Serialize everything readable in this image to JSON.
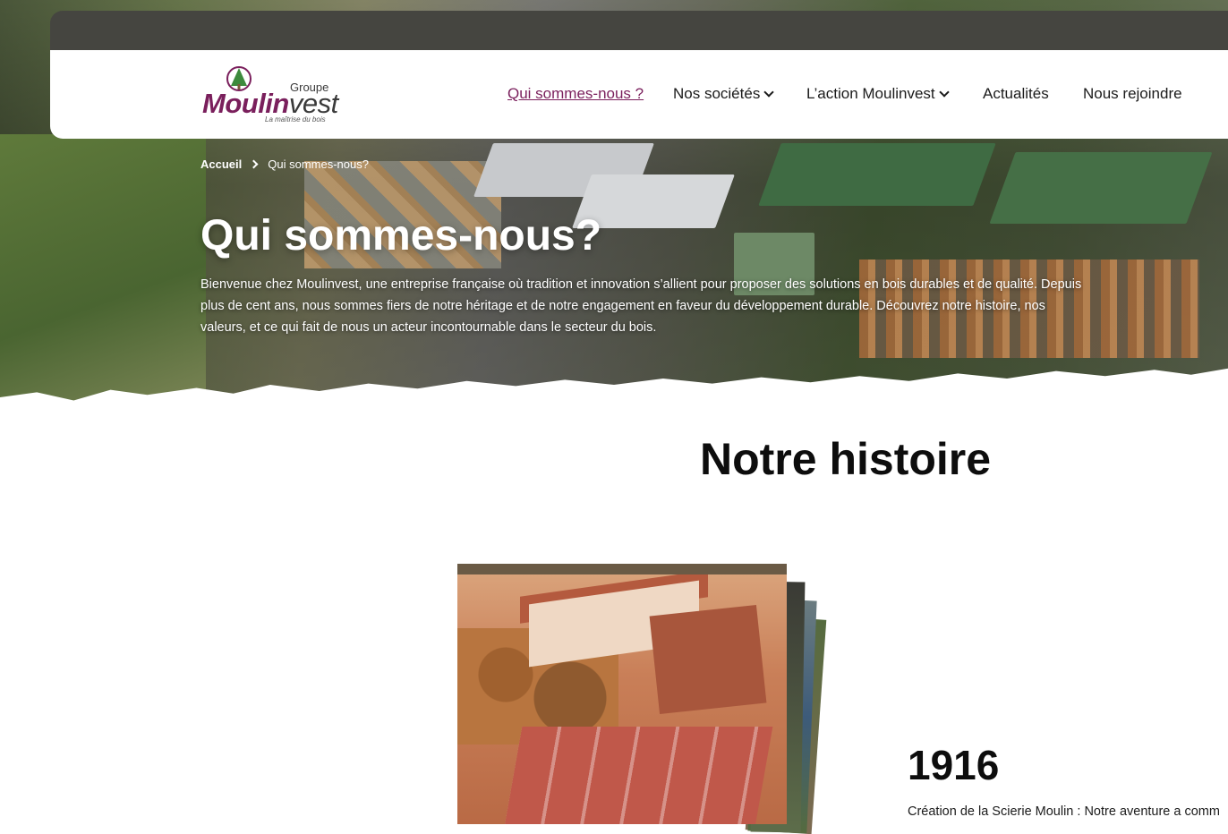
{
  "header": {
    "logo": {
      "group_word": "Groupe",
      "brand_part1": "Moulin",
      "brand_part2": "vest",
      "tagline": "La maîtrise du bois",
      "emblem_icon": "tree-emblem-icon"
    },
    "nav": [
      {
        "label": "Qui sommes-nous ?",
        "active": true
      },
      {
        "label": "Nos sociétés",
        "has_dropdown": true
      },
      {
        "label": "L’action Moulinvest",
        "has_dropdown": true
      },
      {
        "label": "Actualités"
      },
      {
        "label": "Nous rejoindre"
      }
    ]
  },
  "breadcrumb": {
    "home": "Accueil",
    "current": "Qui sommes-nous?"
  },
  "hero": {
    "title": "Qui sommes-nous?",
    "text": "Bienvenue chez Moulinvest, une entreprise française où tradition et innovation s’allient pour proposer des solutions en bois durables et de qualité. Depuis plus de cent ans, nous sommes fiers de notre héritage et de notre engagement en faveur du développement durable. Découvrez notre histoire, nos valeurs, et ce qui fait de nous un acteur incontournable dans le secteur du bois."
  },
  "history": {
    "title": "Notre histoire",
    "year": "1916",
    "text": "Création de la Scierie Moulin : Notre aventure a comm"
  },
  "colors": {
    "brand": "#7a1f5c",
    "topbar": "#454540"
  }
}
